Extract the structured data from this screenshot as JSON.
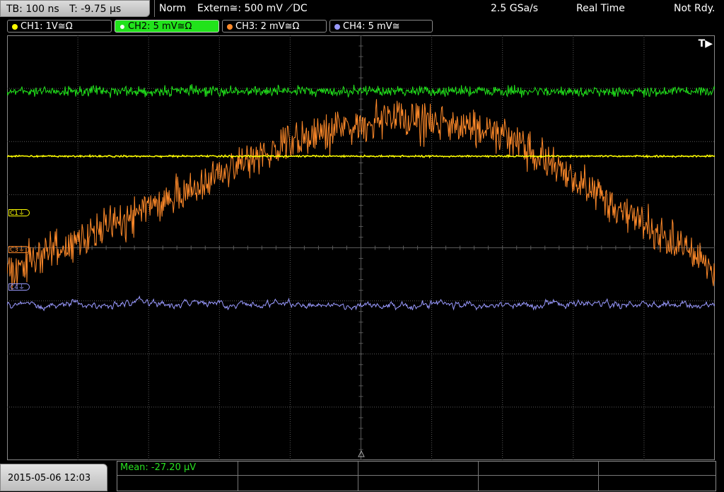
{
  "header": {
    "timebase": "TB: 100 ns",
    "trigger_time": "T: -9.75 µs",
    "mode": "Norm",
    "trigger_source": "Extern≅: 500 mV ⟋DC",
    "sample_rate": "2.5 GSa/s",
    "acq_mode": "Real Time",
    "status": "Not Rdy."
  },
  "channels": [
    {
      "label": "CH1: 1V≅Ω",
      "color": "#ffff00",
      "active": false
    },
    {
      "label": "CH2: 5 mV≅Ω",
      "color": "#21e31b",
      "active": true
    },
    {
      "label": "CH3: 2 mV≅Ω",
      "color": "#ff8a2a",
      "active": false
    },
    {
      "label": "CH4: 5 mV≅",
      "color": "#9a9aff",
      "active": false
    }
  ],
  "markers": {
    "c1": "C1⏚",
    "c3": "C3⏚",
    "c4": "C4⏚",
    "trigger": "T▶"
  },
  "footer": {
    "datetime": "2015-05-06 12:03",
    "measurement": "Mean: -27.20 µV"
  },
  "colors": {
    "ch1": "#ffff00",
    "ch2": "#21e31b",
    "ch3": "#ff8a2a",
    "ch4": "#9a9aff",
    "grid": "#5a5a5a"
  }
}
